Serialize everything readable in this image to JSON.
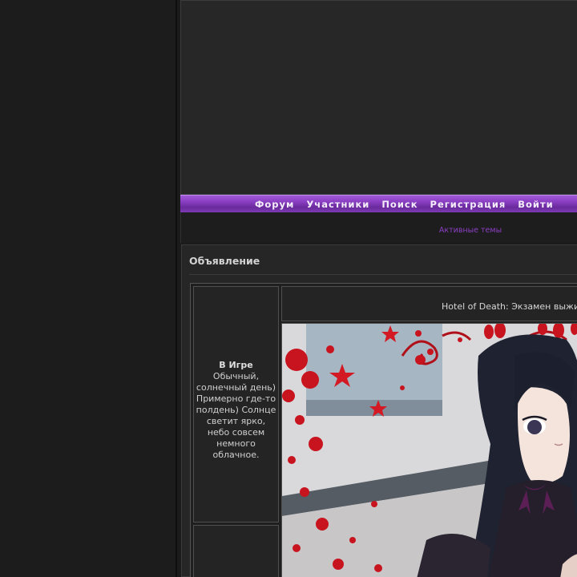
{
  "nav": {
    "items": [
      {
        "label": "Форум"
      },
      {
        "label": "Участники"
      },
      {
        "label": "Поиск"
      },
      {
        "label": "Регистрация"
      },
      {
        "label": "Войти"
      }
    ]
  },
  "sub_nav": {
    "active_topics": "Активные темы"
  },
  "announcement": {
    "title": "Объявление",
    "side": {
      "heading": "В Игре",
      "text": "Обычный, солнечный день) Примерно где-то полдень) Солнце светит ярко, небо совсем немного облачное."
    },
    "banner_title": "Hotel of Death: Экзамен выживания",
    "illustration": "anime-girl-illustration"
  },
  "colors": {
    "background": "#1b1b1b",
    "accent": "#8b3fc4",
    "navbar": "#7d3bb3",
    "panel": "#262626"
  }
}
